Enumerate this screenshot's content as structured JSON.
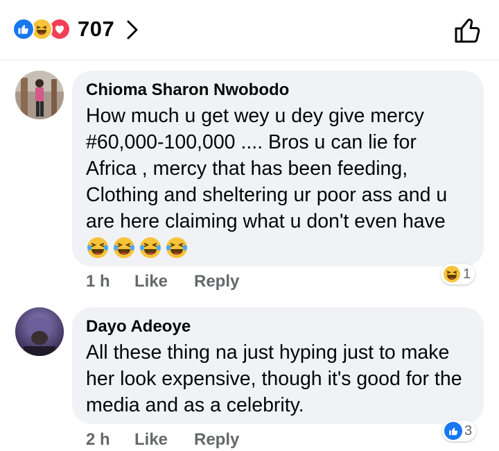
{
  "header": {
    "reactions": [
      "like-icon",
      "haha-icon",
      "love-icon"
    ],
    "reaction_count": "707",
    "chevron": "chevron-right-icon",
    "like_icon": "thumbs-up-outline-icon"
  },
  "comments": [
    {
      "author": "Chioma Sharon Nwobodo",
      "text": "How much u get wey u dey give mercy #60,000-100,000  .... Bros u can lie for Africa , mercy that has been feeding, Clothing and sheltering ur poor ass and u are here claiming what u don't even have",
      "emojis": [
        "laughing-crying-emoji",
        "laughing-crying-emoji",
        "laughing-crying-emoji",
        "laughing-crying-emoji"
      ],
      "time": "1 h",
      "like_label": "Like",
      "reply_label": "Reply",
      "reaction_icon": "haha-icon",
      "reaction_count": "1"
    },
    {
      "author": "Dayo Adeoye",
      "text": "All these thing na just hyping just to make her look expensive, though it's good for the media and as a celebrity.",
      "time": "2 h",
      "like_label": "Like",
      "reply_label": "Reply",
      "reaction_icon": "like-icon",
      "reaction_count": "3"
    }
  ],
  "colors": {
    "like_blue": "#1877f2",
    "haha_yellow": "#f7c33a",
    "love_red": "#f33e58",
    "bubble_bg": "#f0f2f5",
    "meta_gray": "#65676b"
  }
}
